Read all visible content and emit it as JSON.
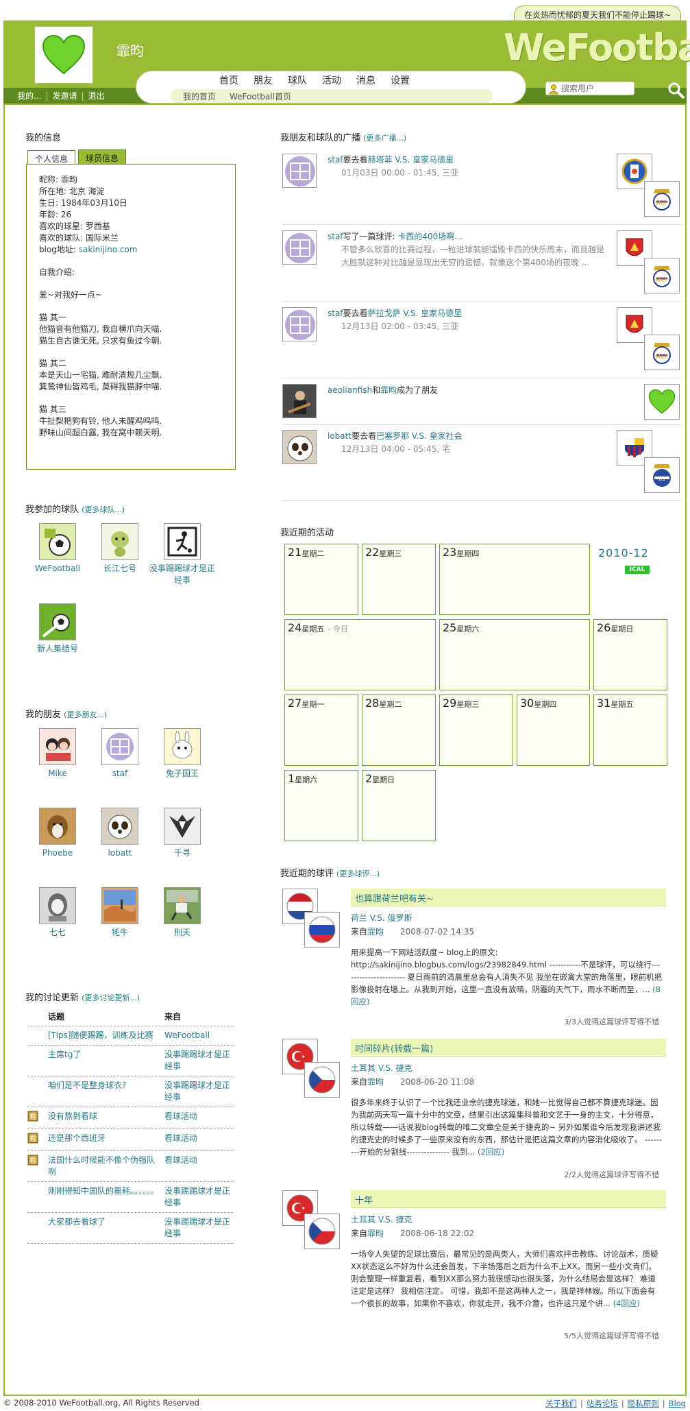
{
  "header": {
    "tagline": "在炎热而忧郁的夏天我们不能停止踢球~",
    "user_name": "霏昀",
    "logo": "WeFootball",
    "user_links": [
      "我的...",
      "发邀请",
      "退出"
    ],
    "nav_main": [
      "首页",
      "朋友",
      "球队",
      "活动",
      "消息",
      "设置"
    ],
    "nav_sub": [
      "我的首页",
      "WeFootball首页"
    ],
    "search_placeholder": "搜索用户"
  },
  "my_info": {
    "title": "我的信息",
    "tabs": [
      "个人信息",
      "球员信息"
    ],
    "lines": [
      "昵称: 霏昀",
      "所在地: 北京 海淀",
      "生日: 1984年03月10日",
      "年龄: 26",
      "喜欢的球星: 罗西基",
      "喜欢的球队: 国际米兰"
    ],
    "blog_label": "blog地址: ",
    "blog_url": "sakinijino.com",
    "intro_label": "自我介绍:",
    "intro_lines": [
      "爱~对我好一点~",
      "",
      "猫 其一",
      "他猫音有他猫刀, 我自横爪向天喵.",
      "猫生自古谁无死, 只求有鱼过今朝.",
      "",
      "猫 其二",
      "本是天山一宅猫, 难耐清规几尘飘.",
      "箕鸷神仙皆鸡毛, 莫碍我猫脖中喵.",
      "",
      "猫 其三",
      "牛扯梨粑狗有铃, 他人未醒鸡鸣鸣.",
      "野味山间超白露, 我在窝中赖天明."
    ]
  },
  "teams": {
    "title": "我参加的球队",
    "more": "(更多球队...)",
    "items": [
      {
        "name": "WeFootball"
      },
      {
        "name": "长江七号"
      },
      {
        "name": "没事踢踢球才是正经事"
      },
      {
        "name": "新人集结号"
      }
    ]
  },
  "friends": {
    "title": "我的朋友",
    "more": "(更多朋友...)",
    "items": [
      {
        "name": "Mike"
      },
      {
        "name": "staf"
      },
      {
        "name": "兔子国王"
      },
      {
        "name": "Phoebe"
      },
      {
        "name": "lobatt"
      },
      {
        "name": "千寻"
      },
      {
        "name": "七七"
      },
      {
        "name": "牦牛"
      },
      {
        "name": "刑天"
      }
    ]
  },
  "discussions": {
    "title": "我的讨论更新",
    "more": "(更多讨论更新...)",
    "col_topic": "话题",
    "col_from": "来自",
    "rows": [
      {
        "topic": "[Tips]随便踢踢，训练及比赛",
        "from": "WeFootball",
        "icon": false
      },
      {
        "topic": "主席tg了",
        "from": "没事踢踢球才是正经事",
        "icon": false
      },
      {
        "topic": "咱们是不是整身球衣?",
        "from": "没事踢踢球才是正经事",
        "icon": false
      },
      {
        "topic": "没有熬到看球",
        "from": "看球活动",
        "icon": true
      },
      {
        "topic": "还是那个西班牙",
        "from": "看球活动",
        "icon": true
      },
      {
        "topic": "法国什么时候能不像个伪强队咧",
        "from": "看球活动",
        "icon": true
      },
      {
        "topic": "刚刚得知中国队的噩耗。。。。。。",
        "from": "没事踢踢球才是正经事",
        "icon": false
      },
      {
        "topic": "大家都去看球了",
        "from": "没事踢踢球才是正经事",
        "icon": false
      }
    ]
  },
  "broadcasts": {
    "title": "我朋友和球队的广播",
    "more": "(更多广播...)",
    "items": [
      {
        "user": "staf",
        "verb": "要去看",
        "link": "赫塔菲 V.S. 皇家马德里",
        "sub": "01月03日 00:00 - 01:45, 三亚",
        "badges": [
          "getafe",
          "realmadrid"
        ]
      },
      {
        "user": "staf",
        "verb": "写了一篇球评: ",
        "link": "卡西的400场啊...",
        "sub": "不管多么欣喜的比赛过程，一粒进球就能擂毁卡西的快乐周末，而且越是大胜就这种对比越是显现出无穷的遗憾，就像这个第400场的夜晚 ...",
        "badges": [
          "zaragoza",
          "realmadrid"
        ]
      },
      {
        "user": "staf",
        "verb": "要去看",
        "link": "萨拉戈萨 V.S. 皇家马德里",
        "sub": "12月13日 02:00 - 03:45, 三亚",
        "badges": [
          "zaragoza",
          "realmadrid"
        ]
      },
      {
        "user": "aeolianfish",
        "verb": "和",
        "link": "霏昀",
        "tail": "成为了朋友",
        "sub": "",
        "badges": [
          "heart"
        ]
      },
      {
        "user": "lobatt",
        "verb": "要去看",
        "link": "巴塞罗那 V.S. 皇家社会",
        "sub": "12月13日 04:00 - 05:45, 宅",
        "badges": [
          "barca",
          "realsociedad"
        ]
      }
    ]
  },
  "calendar": {
    "title": "我近期的活动",
    "month": "2010-12",
    "ical": "ICAL",
    "today_label": "- 今日",
    "days": [
      {
        "d": "21",
        "w": "星期二"
      },
      {
        "d": "22",
        "w": "星期三"
      },
      {
        "d": "23",
        "w": "星期四"
      },
      {
        "d": "24",
        "w": "星期五"
      },
      {
        "d": "25",
        "w": "星期六"
      },
      {
        "d": "26",
        "w": "星期日"
      },
      {
        "d": "27",
        "w": "星期一"
      },
      {
        "d": "28",
        "w": "星期二"
      },
      {
        "d": "29",
        "w": "星期三"
      },
      {
        "d": "30",
        "w": "星期四"
      },
      {
        "d": "31",
        "w": "星期五"
      },
      {
        "d": "1",
        "w": "星期六"
      },
      {
        "d": "2",
        "w": "星期日"
      }
    ]
  },
  "reviews": {
    "title": "我近期的球评",
    "more": "(更多球评...)",
    "items": [
      {
        "title": "也算跟荷兰吧有关~",
        "match": "荷兰 V.S. 俄罗斯",
        "from_label": "来自",
        "author": "霏昀",
        "date": "2008-07-02 14:35",
        "body": "用来提高一下网站活跃度~ blog上的原文: http://sakinijino.blogbus.com/logs/23982849.html -----------不是球评，可以绕行---------------------- 夏日雨前的清晨里总会有人消失不见 我坐在嵌禽大堂的角落里，眼前机把影像投射在墙上。从我到开始，这里一直没有放晴，阴霾的天气下，雨水不断而至，...",
        "reply": "(8回应)",
        "votes": "3/3人觉得这篇球评写得不错",
        "flags": [
          "netherlands",
          "russia"
        ]
      },
      {
        "title": "时间碎片(转载一篇)",
        "match": "土耳其 V.S. 捷克",
        "from_label": "来自",
        "author": "霏昀",
        "date": "2008-06-20 11:08",
        "body": "很多年来终于认识了一个比我还业余的捷克球迷，和她一比觉得自己都不算捷克球迷。因为我前两天写一篇十分中的文章，结果引出这篇集科普和文艺于一身的主文，十分得意，所以转载——话说我blog转载的唯二文章全是关于捷克的~ 另外如果谁今后发现我讲述我的捷克史的时候多了一些原来没有的东西，那估计是把这篇文章的内容消化吸收了。 ---------开始的分割线--------------- 我到...",
        "reply": "(2回应)",
        "votes": "2/2人觉得这篇球评写得不错",
        "flags": [
          "turkey",
          "czech"
        ]
      },
      {
        "title": "十年",
        "match": "土耳其 V.S. 捷克",
        "from_label": "来自",
        "author": "霏昀",
        "date": "2008-06-18 22:02",
        "body": "一场令人失望的足球比赛后，最常见的是两类人，大师们喜欢抨击教练、讨论战术，质疑XX状态这么不好为什么还会首发，下半场落后之后为什么不上XX。而另一些小文青们，则会整理一样重复着，看到XX那么努力我很感动也很失落，为什么结局会是这样？ 难道注定是这样？ 我相信注定。 可惜，我却不是这两种人之一，我是祥林嫂。所以下面会有一个很长的故事，如果你不喜欢，你就走开，我不介意，也许这只是个讲...",
        "reply": "(4回应)",
        "votes": "5/5人觉得这篇球评写得不错",
        "flags": [
          "turkey",
          "czech"
        ]
      }
    ]
  },
  "footer": {
    "copyright": "© 2008-2010 WeFootball.org, All Rights Reserved",
    "links": [
      "关于我们",
      "站务论坛",
      "隐私原则",
      "Blog"
    ]
  }
}
